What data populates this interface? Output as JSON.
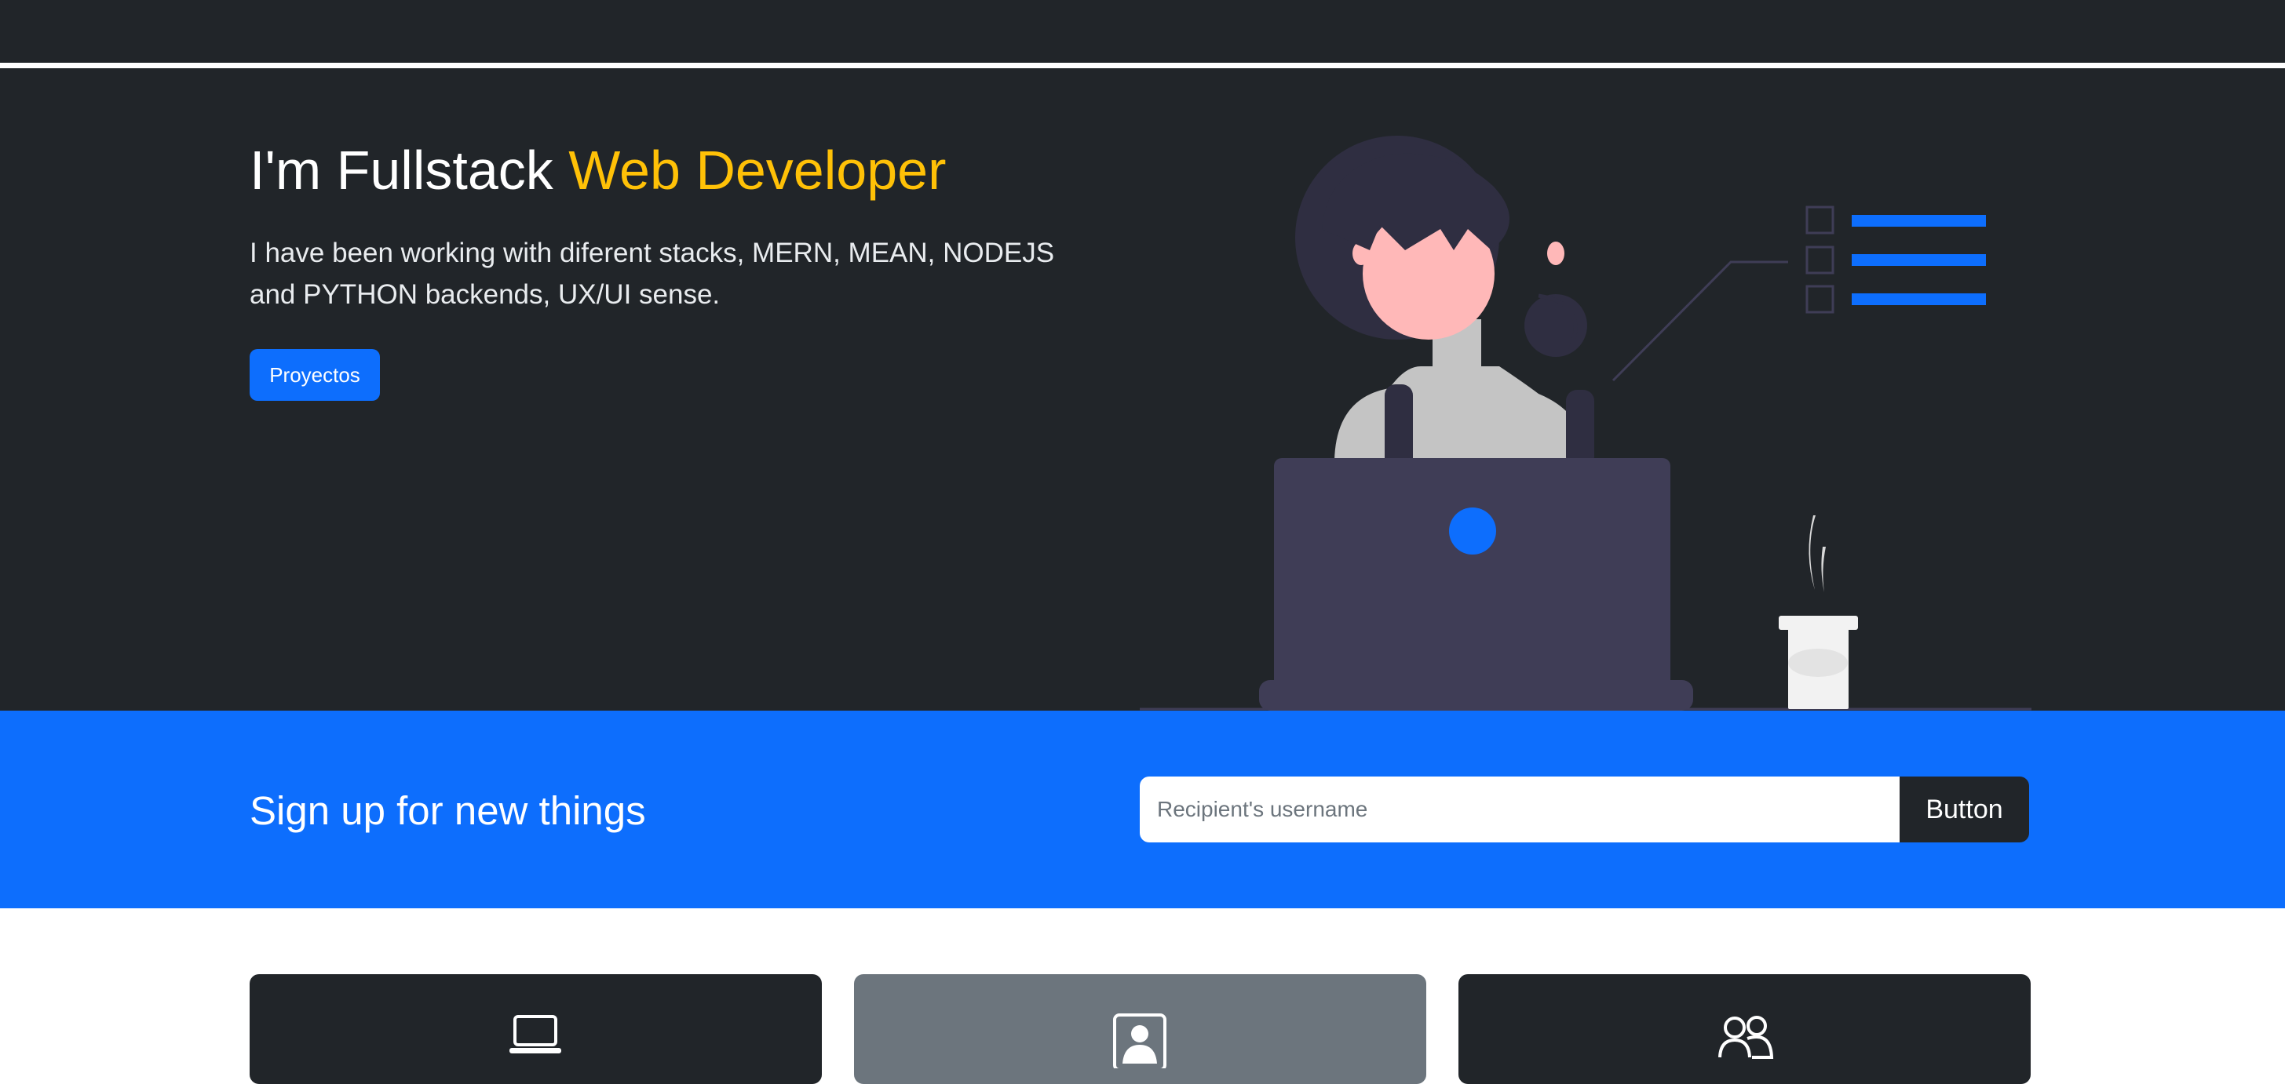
{
  "hero": {
    "title_main": "I'm Fullstack ",
    "title_accent": "Web Developer",
    "description": "I have been working with diferent stacks, MERN, MEAN, NODEJS and PYTHON backends, UX/UI sense.",
    "button_label": "Proyectos"
  },
  "signup": {
    "title": "Sign up for new things",
    "input_placeholder": "Recipient's username",
    "button_label": "Button"
  },
  "cards": [
    {
      "icon": "laptop-icon",
      "color": "#212529"
    },
    {
      "icon": "person-badge-icon",
      "color": "#6c757d"
    },
    {
      "icon": "people-icon",
      "color": "#212529"
    }
  ],
  "colors": {
    "dark": "#212529",
    "accent": "#ffc107",
    "primary": "#0d6efd",
    "secondary": "#6c757d"
  }
}
